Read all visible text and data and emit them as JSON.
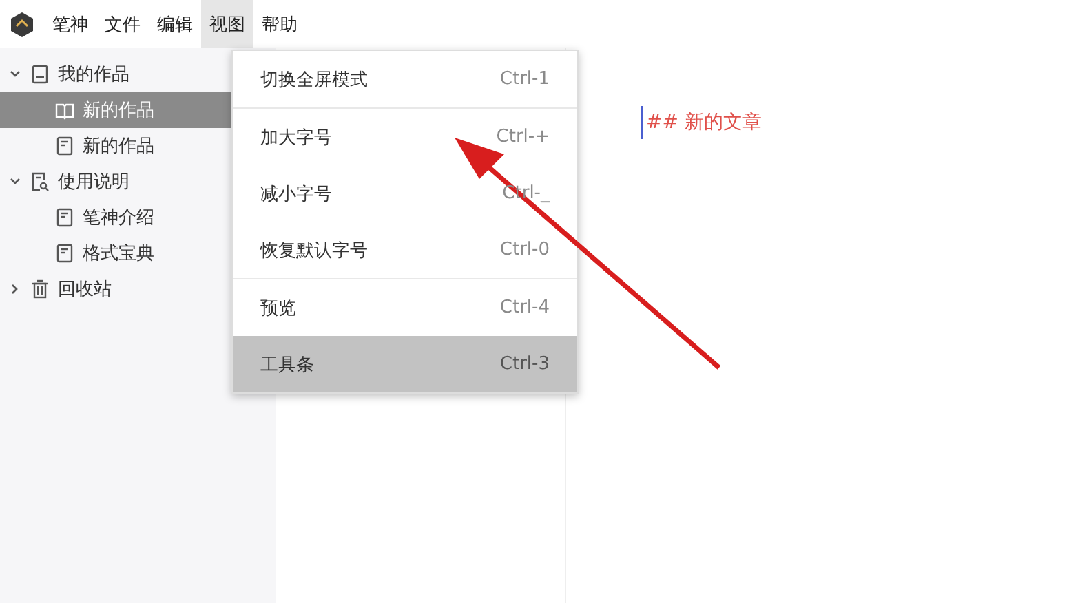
{
  "menubar": [
    {
      "label": "笔神",
      "selected": false
    },
    {
      "label": "文件",
      "selected": false
    },
    {
      "label": "编辑",
      "selected": false
    },
    {
      "label": "视图",
      "selected": true
    },
    {
      "label": "帮助",
      "selected": false
    }
  ],
  "sidebar": {
    "items": [
      {
        "label": "我的作品",
        "kind": "notebook",
        "expanded": true,
        "selected": false,
        "children": [
          {
            "label": "新的作品",
            "kind": "book",
            "selected": true
          },
          {
            "label": "新的作品",
            "kind": "page",
            "selected": false
          }
        ]
      },
      {
        "label": "使用说明",
        "kind": "guide",
        "expanded": true,
        "selected": false,
        "children": [
          {
            "label": "笔神介绍",
            "kind": "page",
            "selected": false
          },
          {
            "label": "格式宝典",
            "kind": "page",
            "selected": false
          }
        ]
      },
      {
        "label": "回收站",
        "kind": "trash",
        "expanded": false,
        "selected": false
      }
    ]
  },
  "menu": {
    "items": [
      {
        "label": "切换全屏模式",
        "shortcut": "Ctrl-1",
        "selected": false,
        "separator_after": true
      },
      {
        "label": "加大字号",
        "shortcut": "Ctrl-+",
        "selected": false,
        "separator_after": false
      },
      {
        "label": "减小字号",
        "shortcut": "Ctrl-_",
        "selected": false,
        "separator_after": false
      },
      {
        "label": "恢复默认字号",
        "shortcut": "Ctrl-0",
        "selected": false,
        "separator_after": true
      },
      {
        "label": "预览",
        "shortcut": "Ctrl-4",
        "selected": false,
        "separator_after": false
      },
      {
        "label": "工具条",
        "shortcut": "Ctrl-3",
        "selected": true,
        "separator_after": false
      }
    ]
  },
  "editor": {
    "text": "## 新的文章"
  }
}
